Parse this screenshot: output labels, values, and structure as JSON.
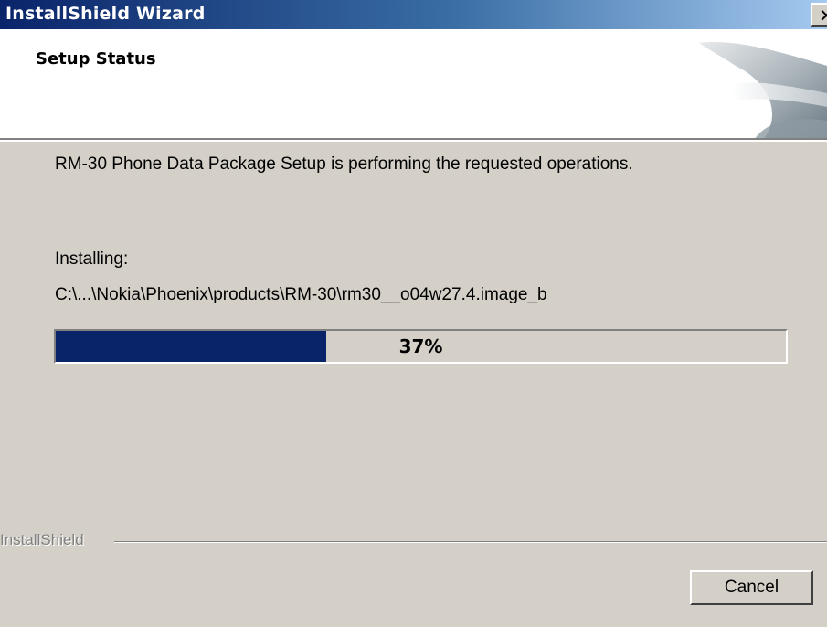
{
  "window": {
    "title": "InstallShield Wizard",
    "close_glyph": "✕"
  },
  "header": {
    "title": "Setup Status"
  },
  "main": {
    "description": "RM-30 Phone Data Package Setup is performing the requested operations.",
    "installing_label": "Installing:",
    "file_path": "C:\\...\\Nokia\\Phoenix\\products\\RM-30\\rm30__o04w27.4.image_b",
    "progress": {
      "percent": 37,
      "label": "37%"
    }
  },
  "footer": {
    "brand": "InstallShield",
    "cancel_label": "Cancel"
  },
  "colors": {
    "progress_fill": "#0a246a",
    "title_bar_start": "#0a246a",
    "title_bar_end": "#a6caf0",
    "dialog_face": "#d4d0c8"
  }
}
